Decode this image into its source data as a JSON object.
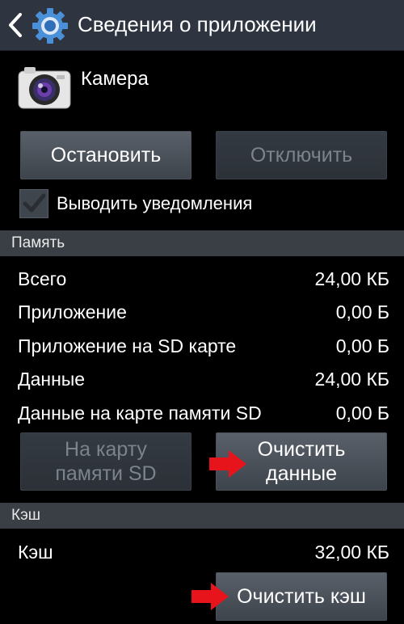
{
  "header": {
    "title": "Сведения о приложении"
  },
  "app": {
    "name": "Камера"
  },
  "actions": {
    "stop_label": "Остановить",
    "disable_label": "Отключить"
  },
  "notifications": {
    "label": "Выводить уведомления",
    "checked": true
  },
  "memory": {
    "section_title": "Память",
    "rows": [
      {
        "label": "Всего",
        "value": "24,00 КБ"
      },
      {
        "label": "Приложение",
        "value": "0,00 Б"
      },
      {
        "label": "Приложение на SD карте",
        "value": "0,00 Б"
      },
      {
        "label": "Данные",
        "value": "24,00 КБ"
      },
      {
        "label": "Данные на карте памяти SD",
        "value": "0,00 Б"
      }
    ],
    "move_sd_label_line1": "На карту",
    "move_sd_label_line2": "памяти SD",
    "clear_data_label_line1": "Очистить",
    "clear_data_label_line2": "данные"
  },
  "cache": {
    "section_title": "Кэш",
    "row": {
      "label": "Кэш",
      "value": "32,00 КБ"
    },
    "clear_cache_label": "Очистить кэш"
  },
  "colors": {
    "annotation_arrow": "#e8141b",
    "header_bg": "#2e3540",
    "section_bg": "#3a3f46"
  }
}
